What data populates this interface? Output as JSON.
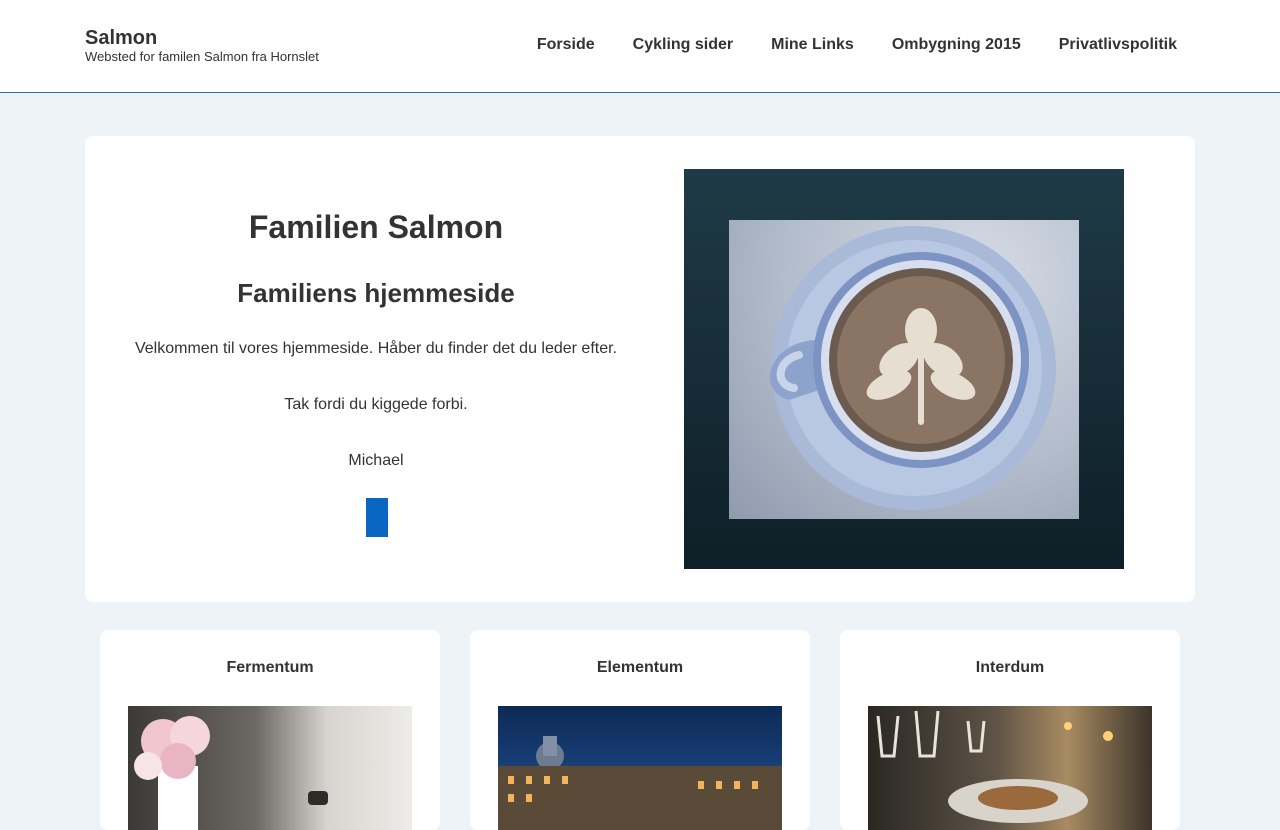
{
  "header": {
    "site_title": "Salmon",
    "tagline": "Websted for familen Salmon fra Hornslet",
    "nav": [
      {
        "label": "Forside"
      },
      {
        "label": "Cykling sider"
      },
      {
        "label": "Mine Links"
      },
      {
        "label": "Ombygning 2015"
      },
      {
        "label": "Privatlivspolitik"
      }
    ]
  },
  "hero": {
    "title": "Familien Salmon",
    "subtitle": "Familiens hjemmeside",
    "paragraphs": [
      "Velkommen til vores hjemmeside. Håber du finder det du leder efter.",
      "Tak fordi du kiggede forbi.",
      "Michael"
    ],
    "button_color": "#0a66c2",
    "image_subject": "latte-art-coffee-cup"
  },
  "cards": [
    {
      "title": "Fermentum",
      "image_subject": "pink-roses-in-white-pitcher"
    },
    {
      "title": "Elementum",
      "image_subject": "city-canal-at-night"
    },
    {
      "title": "Interdum",
      "image_subject": "restaurant-table-with-wine-glasses"
    }
  ],
  "colors": {
    "accent": "#1f6fb5",
    "page_background": "#eef3f8",
    "text": "#333333"
  }
}
